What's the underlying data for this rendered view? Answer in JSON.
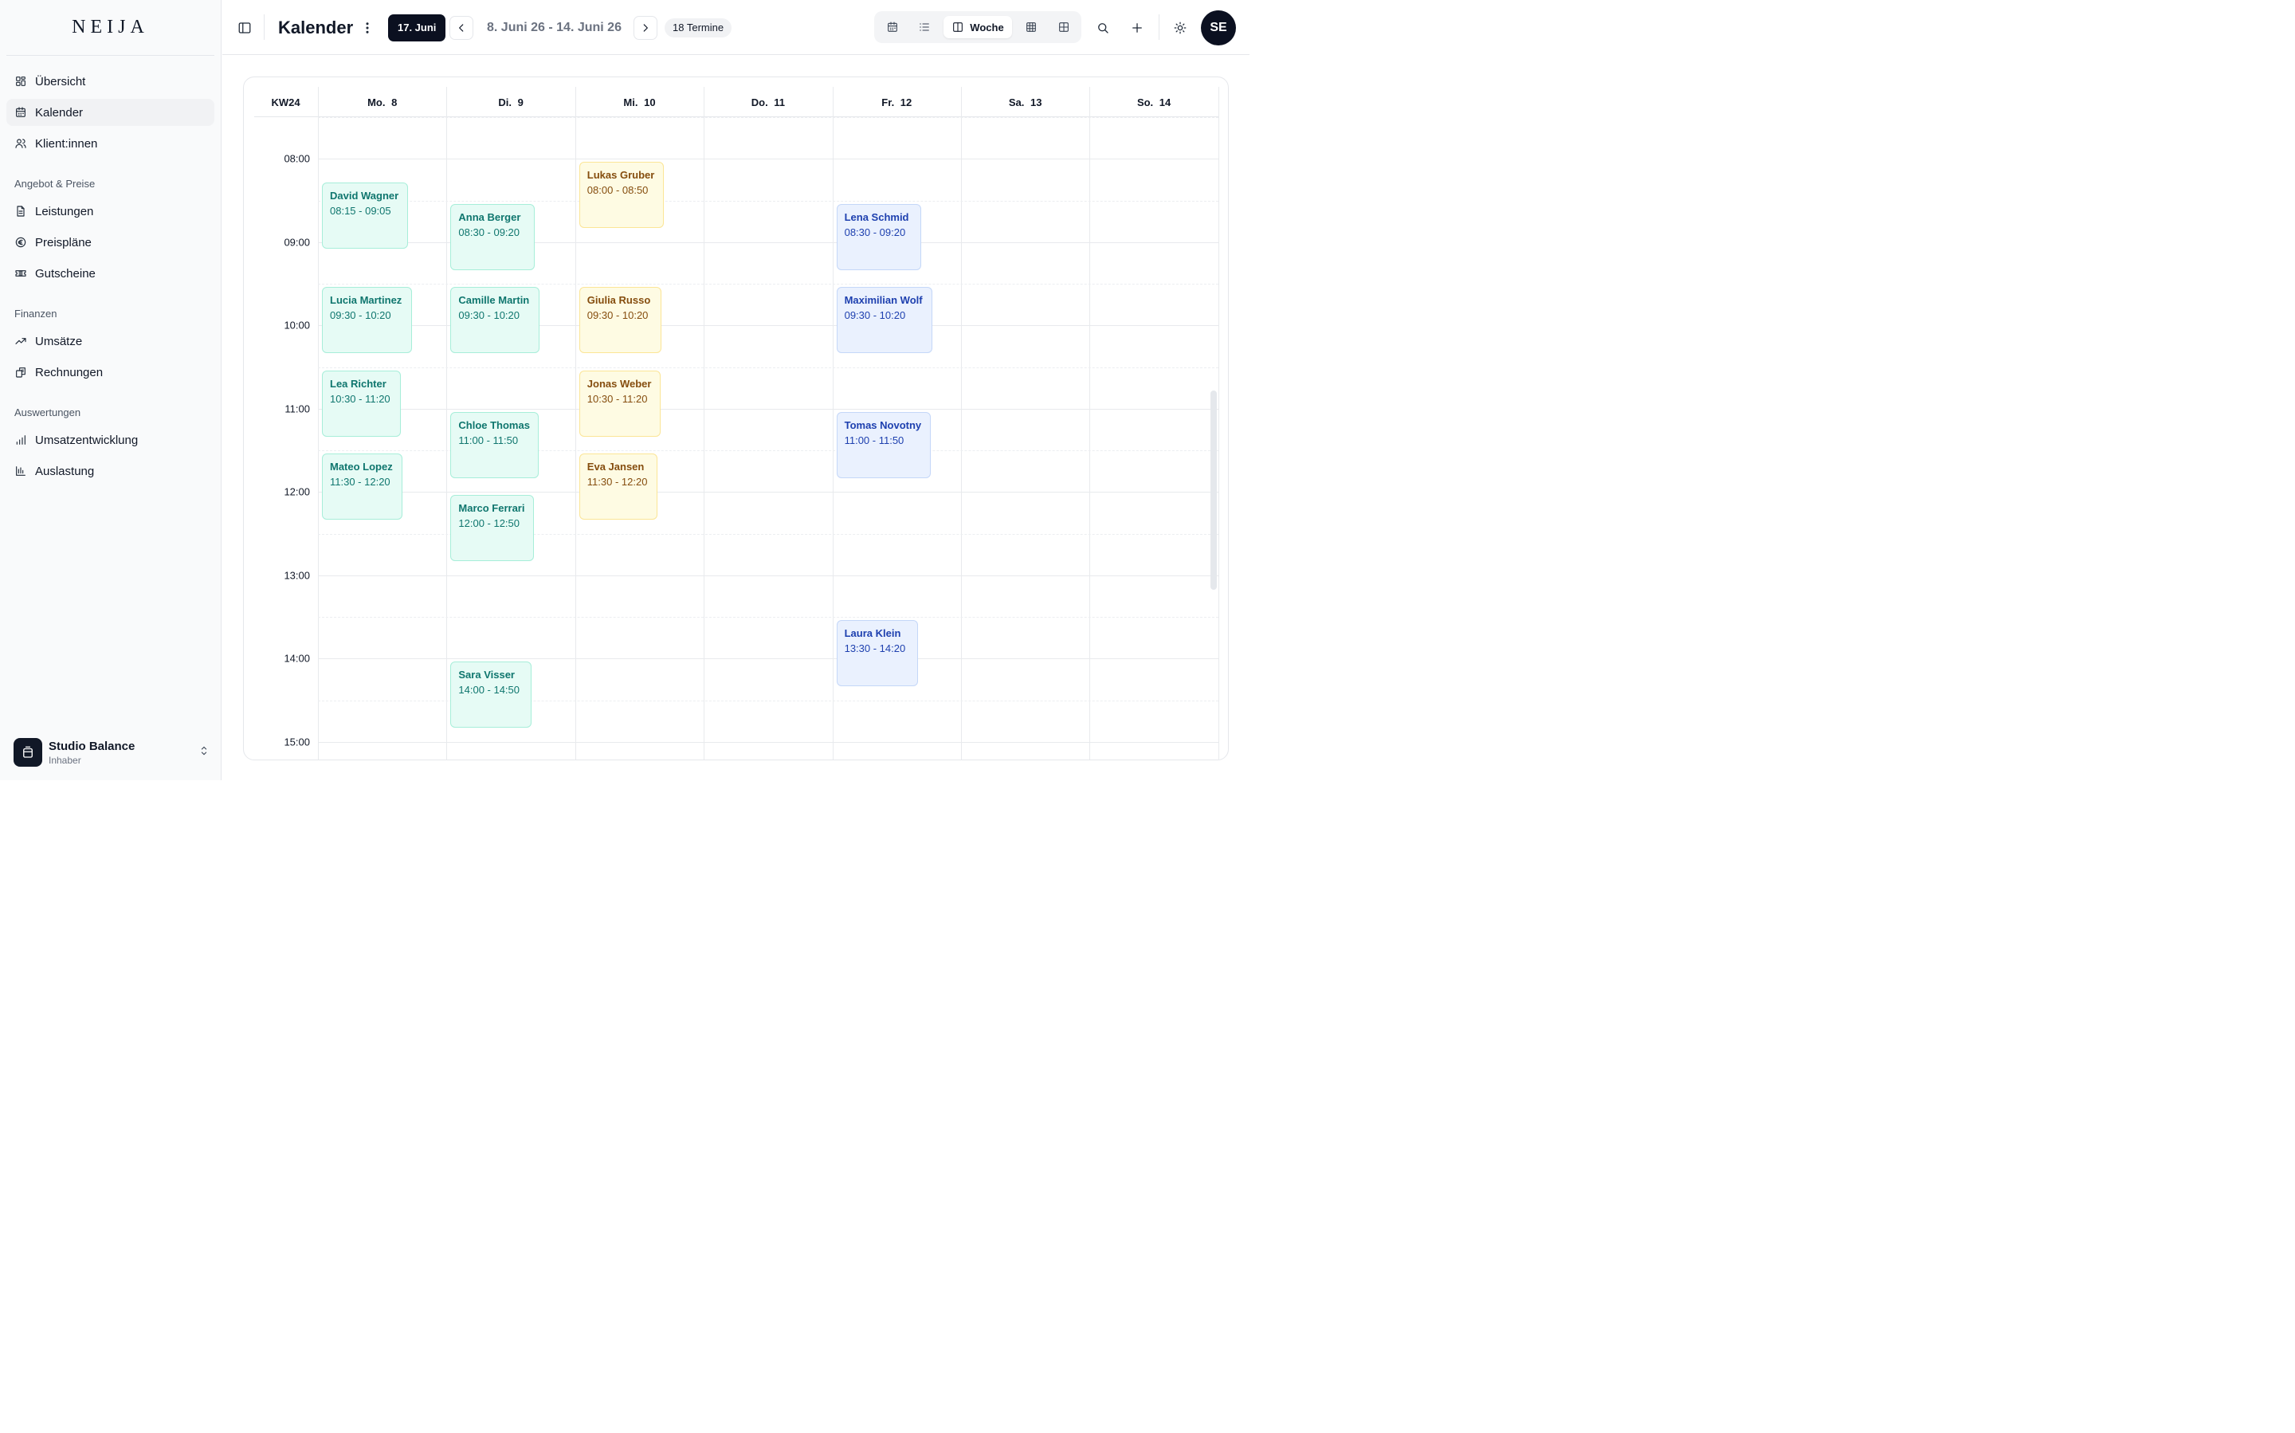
{
  "brand": "NEIJA",
  "sidebar": {
    "main": [
      {
        "label": "Übersicht",
        "icon": "dashboard-icon"
      },
      {
        "label": "Kalender",
        "icon": "calendar-icon",
        "active": true
      },
      {
        "label": "Klient:innen",
        "icon": "users-icon"
      }
    ],
    "sections": [
      {
        "heading": "Angebot & Preise",
        "items": [
          {
            "label": "Leistungen",
            "icon": "document-icon"
          },
          {
            "label": "Preispläne",
            "icon": "euro-icon"
          },
          {
            "label": "Gutscheine",
            "icon": "ticket-icon"
          }
        ]
      },
      {
        "heading": "Finanzen",
        "items": [
          {
            "label": "Umsätze",
            "icon": "trending-up-icon"
          },
          {
            "label": "Rechnungen",
            "icon": "invoice-icon"
          }
        ]
      },
      {
        "heading": "Auswertungen",
        "items": [
          {
            "label": "Umsatzentwicklung",
            "icon": "bar-chart-icon"
          },
          {
            "label": "Auslastung",
            "icon": "bar-chart-2-icon"
          }
        ]
      }
    ],
    "studio": {
      "name": "Studio Balance",
      "role": "Inhaber"
    }
  },
  "header": {
    "title": "Kalender",
    "today_label": "17. Juni",
    "range": "8. Juni 26 - 14. Juni 26",
    "count": "18 Termine",
    "view_label": "Woche",
    "avatar": "SE"
  },
  "calendar": {
    "week_label": "KW24",
    "days": [
      "Mo. 8",
      "Di. 9",
      "Mi. 10",
      "Do. 11",
      "Fr. 12",
      "Sa. 13",
      "So. 14"
    ],
    "hours": [
      "08:00",
      "09:00",
      "10:00",
      "11:00",
      "12:00",
      "13:00",
      "14:00",
      "15:00"
    ],
    "events": [
      {
        "name": "David Wagner",
        "time": "08:15 - 09:05",
        "day": 0,
        "start": 8.25,
        "end": 9.0833,
        "color": "teal"
      },
      {
        "name": "Lucia Martinez",
        "time": "09:30 - 10:20",
        "day": 0,
        "start": 9.5,
        "end": 10.3333,
        "color": "teal"
      },
      {
        "name": "Lea Richter",
        "time": "10:30 - 11:20",
        "day": 0,
        "start": 10.5,
        "end": 11.3333,
        "color": "teal"
      },
      {
        "name": "Mateo Lopez",
        "time": "11:30 - 12:20",
        "day": 0,
        "start": 11.5,
        "end": 12.3333,
        "color": "teal"
      },
      {
        "name": "Anna Berger",
        "time": "08:30 - 09:20",
        "day": 1,
        "start": 8.5,
        "end": 9.3333,
        "color": "teal"
      },
      {
        "name": "Camille Martin",
        "time": "09:30 - 10:20",
        "day": 1,
        "start": 9.5,
        "end": 10.3333,
        "color": "teal"
      },
      {
        "name": "Chloe Thomas",
        "time": "11:00 - 11:50",
        "day": 1,
        "start": 11.0,
        "end": 11.8333,
        "color": "teal"
      },
      {
        "name": "Marco Ferrari",
        "time": "12:00 - 12:50",
        "day": 1,
        "start": 12.0,
        "end": 12.8333,
        "color": "teal"
      },
      {
        "name": "Sara Visser",
        "time": "14:00 - 14:50",
        "day": 1,
        "start": 14.0,
        "end": 14.8333,
        "color": "teal"
      },
      {
        "name": "Lukas Gruber",
        "time": "08:00 - 08:50",
        "day": 2,
        "start": 8.0,
        "end": 8.8333,
        "color": "yellow"
      },
      {
        "name": "Giulia Russo",
        "time": "09:30 - 10:20",
        "day": 2,
        "start": 9.5,
        "end": 10.3333,
        "color": "yellow"
      },
      {
        "name": "Jonas Weber",
        "time": "10:30 - 11:20",
        "day": 2,
        "start": 10.5,
        "end": 11.3333,
        "color": "yellow"
      },
      {
        "name": "Eva Jansen",
        "time": "11:30 - 12:20",
        "day": 2,
        "start": 11.5,
        "end": 12.3333,
        "color": "yellow"
      },
      {
        "name": "Lena Schmid",
        "time": "08:30 - 09:20",
        "day": 4,
        "start": 8.5,
        "end": 9.3333,
        "color": "blue"
      },
      {
        "name": "Maximilian Wolf",
        "time": "09:30 - 10:20",
        "day": 4,
        "start": 9.5,
        "end": 10.3333,
        "color": "blue"
      },
      {
        "name": "Tomas Novotny",
        "time": "11:00 - 11:50",
        "day": 4,
        "start": 11.0,
        "end": 11.8333,
        "color": "blue"
      },
      {
        "name": "Laura Klein",
        "time": "13:30 - 14:20",
        "day": 4,
        "start": 13.5,
        "end": 14.3333,
        "color": "blue"
      }
    ]
  }
}
